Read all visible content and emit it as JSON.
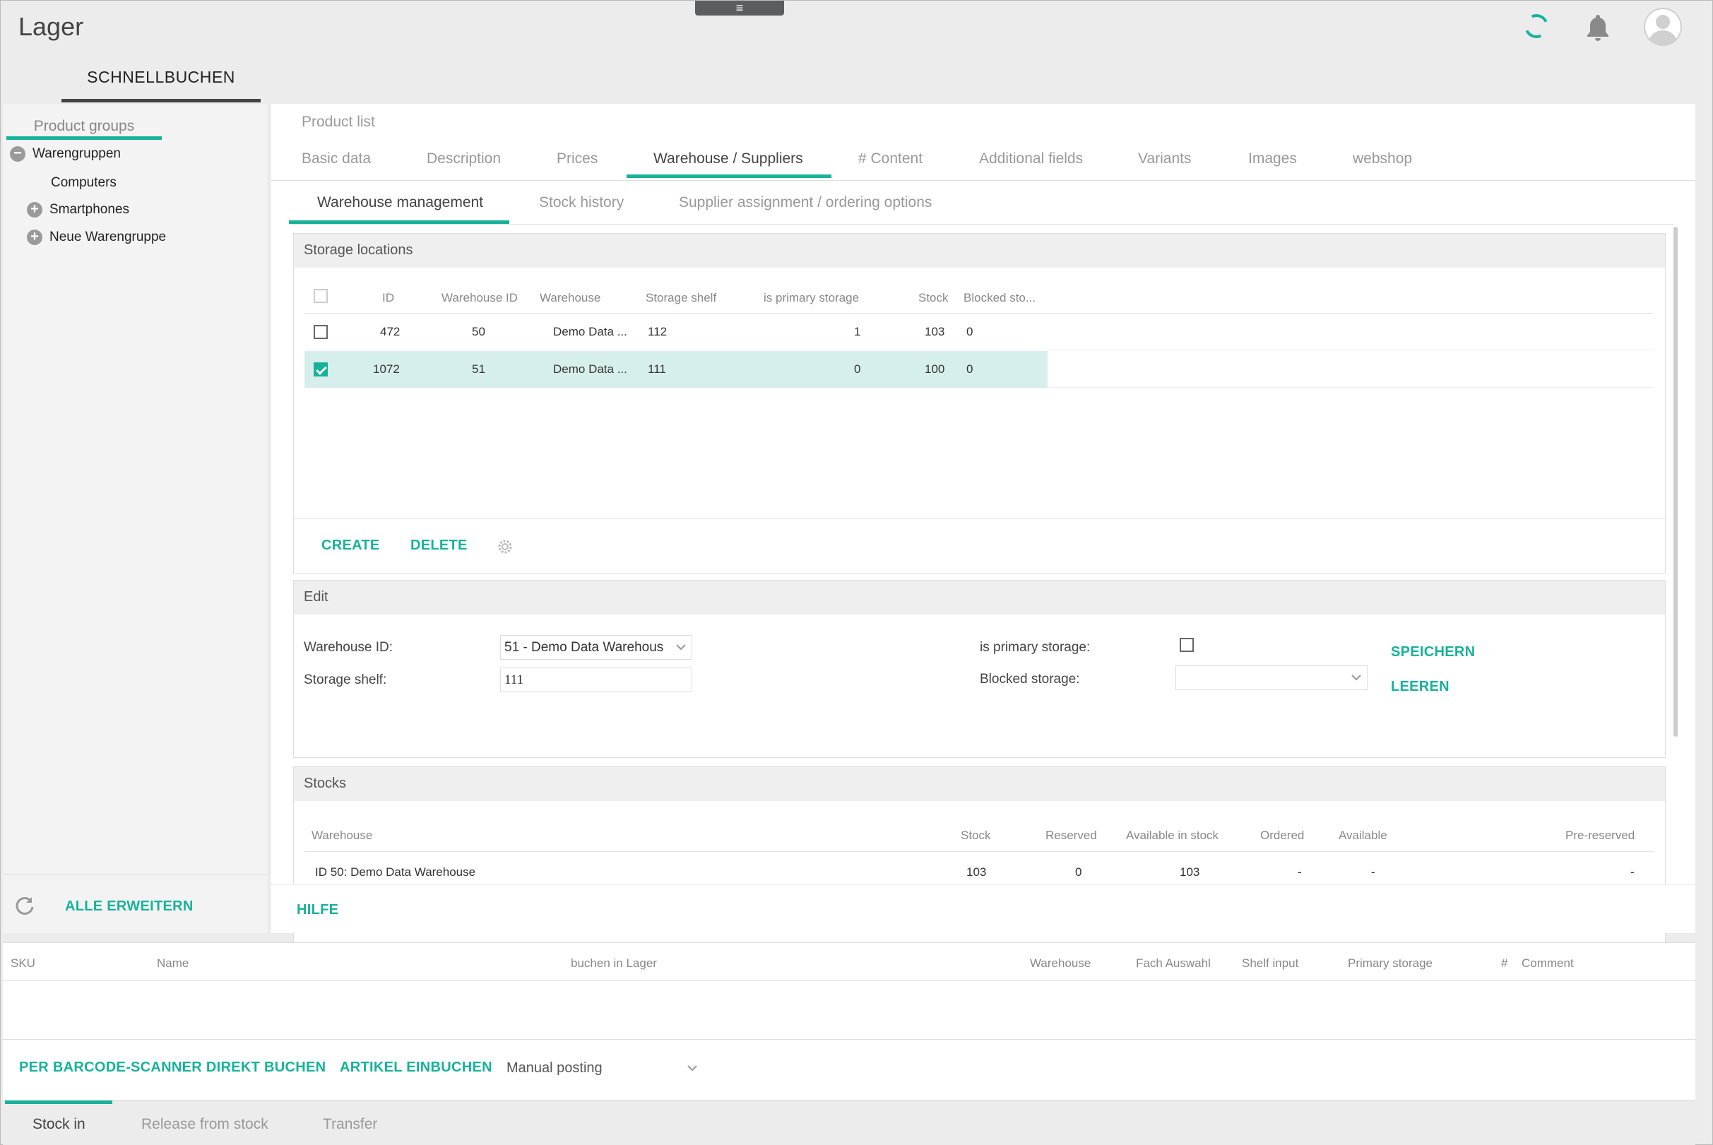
{
  "app": {
    "title": "Lager",
    "menu_glyph": "≡"
  },
  "header": {
    "top_tab": "SCHNELLBUCHEN"
  },
  "sidebar": {
    "tab": "Product groups",
    "tree": [
      {
        "label": "Warengruppen",
        "toggle": "−"
      },
      {
        "label": "Computers",
        "toggle": ""
      },
      {
        "label": "Smartphones",
        "toggle": "+"
      },
      {
        "label": "Neue Warengruppe",
        "toggle": "+"
      }
    ],
    "expand_all": "ALLE ERWEITERN"
  },
  "main": {
    "title": "Product list",
    "tabs": [
      "Basic data",
      "Description",
      "Prices",
      "Warehouse / Suppliers",
      "# Content",
      "Additional fields",
      "Variants",
      "Images",
      "webshop"
    ],
    "active_tab": "Warehouse / Suppliers",
    "sub_tabs": [
      "Warehouse management",
      "Stock history",
      "Supplier assignment / ordering options"
    ],
    "active_sub_tab": "Warehouse management"
  },
  "storage_locations": {
    "title": "Storage locations",
    "columns": [
      "ID",
      "Warehouse ID",
      "Warehouse",
      "Storage shelf",
      "is primary storage",
      "Stock",
      "Blocked sto..."
    ],
    "rows": [
      {
        "id": "472",
        "warehouse_id": "50",
        "warehouse": "Demo Data ...",
        "shelf": "112",
        "primary": "1",
        "stock": "103",
        "blocked": "0",
        "checked": false
      },
      {
        "id": "1072",
        "warehouse_id": "51",
        "warehouse": "Demo Data ...",
        "shelf": "111",
        "primary": "0",
        "stock": "100",
        "blocked": "0",
        "checked": true
      }
    ],
    "create": "CREATE",
    "delete": "DELETE"
  },
  "edit": {
    "title": "Edit",
    "warehouse_id_label": "Warehouse ID:",
    "warehouse_id_value": "51 - Demo Data Warehous",
    "storage_shelf_label": "Storage shelf:",
    "storage_shelf_value": "111",
    "primary_label": "is primary storage:",
    "blocked_label": "Blocked storage:",
    "blocked_value": "",
    "save": "SPEICHERN",
    "clear": "LEEREN"
  },
  "stocks": {
    "title": "Stocks",
    "columns": [
      "Warehouse",
      "Stock",
      "Reserved",
      "Available in stock",
      "Ordered",
      "Available",
      "Pre-reserved"
    ],
    "rows": [
      {
        "warehouse": "ID 50: Demo Data Warehouse",
        "stock": "103",
        "reserved": "0",
        "available_in_stock": "103",
        "ordered": "-",
        "available": "-",
        "pre_reserved": "-"
      }
    ]
  },
  "help": "HILFE",
  "booking_table": {
    "columns": [
      "SKU",
      "Name",
      "buchen in Lager",
      "Warehouse",
      "Fach Auswahl",
      "Shelf input",
      "Primary storage",
      "#",
      "Comment"
    ]
  },
  "booking_actions": {
    "barcode": "PER BARCODE-SCANNER DIREKT BUCHEN",
    "book_in": "ARTIKEL EINBUCHEN",
    "mode": "Manual posting"
  },
  "bottom_tabs": [
    "Stock in",
    "Release from stock",
    "Transfer"
  ],
  "colors": {
    "accent": "#17b29a",
    "selected_row": "#d7efec"
  }
}
